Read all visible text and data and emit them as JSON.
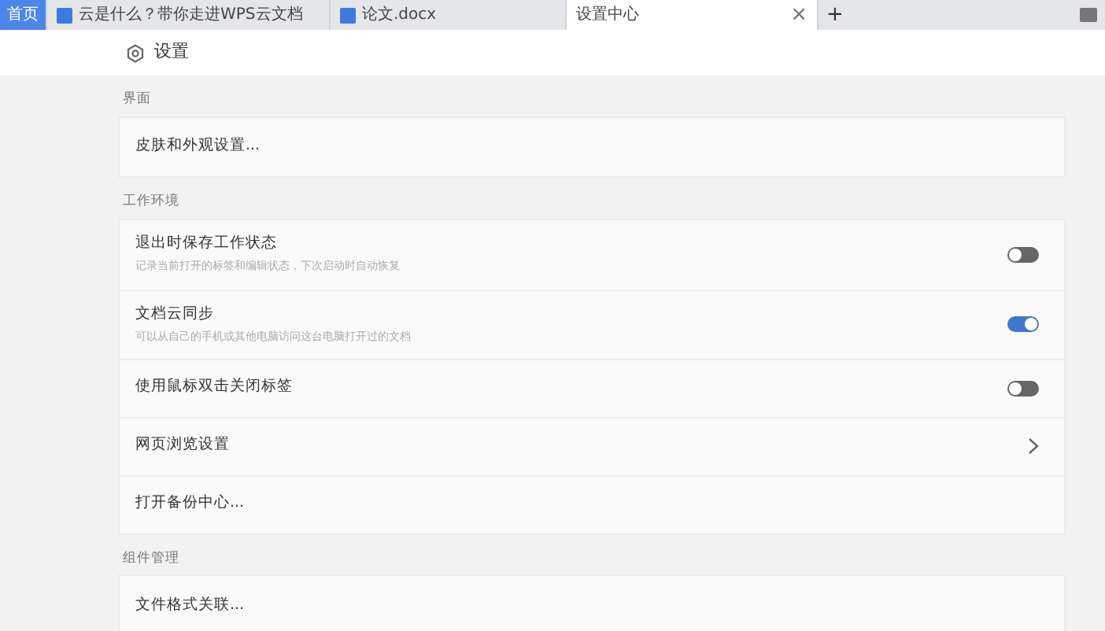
{
  "tabs": [
    {
      "kind": "home",
      "label": "首页",
      "selected": false
    },
    {
      "kind": "doc",
      "label": "云是什么？带你走进WPS云文档",
      "selected": false
    },
    {
      "kind": "doc",
      "label": "论文.docx",
      "selected": false
    },
    {
      "kind": "page",
      "label": "设置中心",
      "selected": true,
      "close": "×"
    }
  ],
  "new_tab": "+",
  "page_title": "设置",
  "sections": [
    {
      "label": "界面",
      "rows": [
        {
          "kind": "link",
          "title": "皮肤和外观设置..."
        }
      ]
    },
    {
      "label": "工作环境",
      "rows": [
        {
          "kind": "toggle",
          "title": "退出时保存工作状态",
          "description": "记录当前打开的标签和编辑状态，下次启动时自动恢复",
          "on": false
        },
        {
          "kind": "toggle",
          "title": "文档云同步",
          "description": "可以从自己的手机或其他电脑访问这台电脑打开过的文档",
          "on": true
        },
        {
          "kind": "toggle",
          "title": "使用鼠标双击关闭标签",
          "on": false
        },
        {
          "kind": "chevron",
          "title": "网页浏览设置"
        },
        {
          "kind": "link",
          "title": "打开备份中心..."
        }
      ]
    },
    {
      "label": "组件管理",
      "rows": [
        {
          "kind": "link",
          "title": "文件格式关联..."
        }
      ]
    }
  ]
}
